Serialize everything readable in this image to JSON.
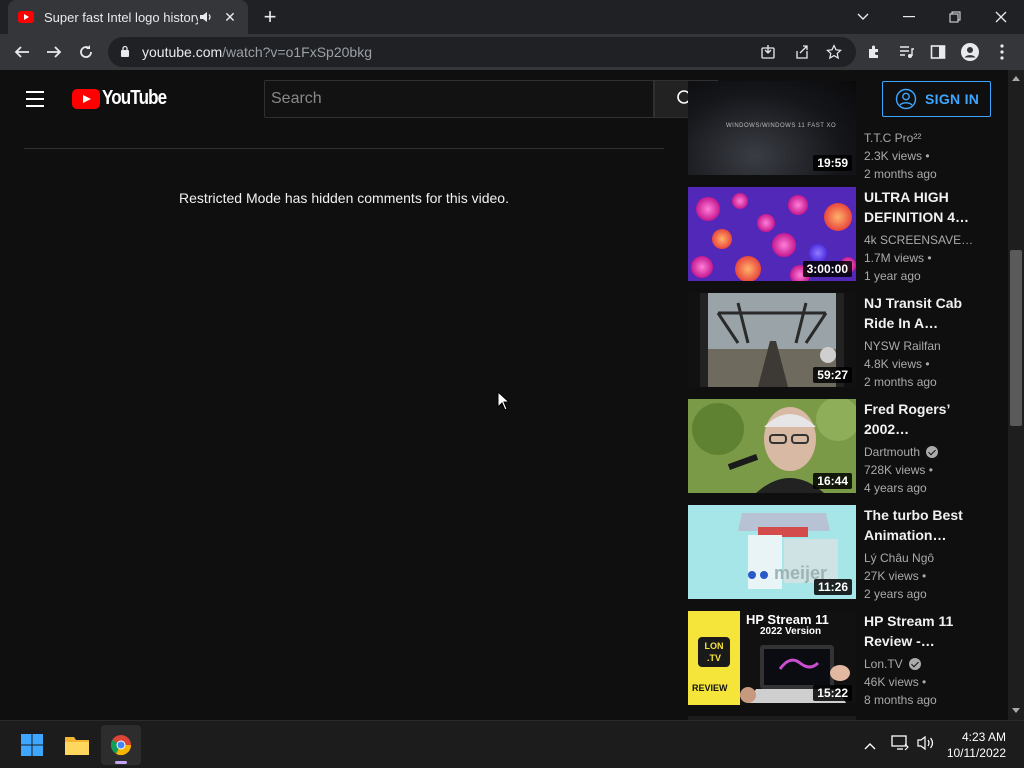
{
  "browser": {
    "tab_title": "Super fast Intel logo history",
    "new_tab_label": "+",
    "url_domain": "youtube.com",
    "url_path": "/watch?v=o1FxSp20bkg"
  },
  "youtube": {
    "logo_text": "YouTube",
    "search_placeholder": "Search",
    "signin_label": "SIGN IN"
  },
  "main": {
    "restricted_message": "Restricted Mode has hidden comments for this video."
  },
  "related": [
    {
      "title": "",
      "channel": "T.T.C Pro²²",
      "views": "2.3K views •",
      "ago": "2 months ago",
      "duration": "19:59",
      "verified": false
    },
    {
      "title": "ULTRA HIGH DEFINITION 4…",
      "channel": "4k SCREENSAVE…",
      "views": "1.7M views •",
      "ago": "1 year ago",
      "duration": "3:00:00",
      "verified": false
    },
    {
      "title": "NJ Transit Cab Ride In A…",
      "channel": "NYSW Railfan",
      "views": "4.8K views •",
      "ago": "2 months ago",
      "duration": "59:27",
      "verified": false
    },
    {
      "title": "Fred Rogers’ 2002…",
      "channel": "Dartmouth",
      "views": "728K views •",
      "ago": "4 years ago",
      "duration": "16:44",
      "verified": true
    },
    {
      "title": "The turbo Best Animation…",
      "channel": "Lý Châu Ngô",
      "views": "27K views •",
      "ago": "2 years ago",
      "duration": "11:26",
      "verified": false
    },
    {
      "title": "HP Stream 11 Review -…",
      "channel": "Lon.TV",
      "views": "46K views •",
      "ago": "8 months ago",
      "duration": "15:22",
      "verified": true
    }
  ],
  "thumb_text": {
    "first_overlay": "WINDOWS/WINDOWS 11 FAST XO",
    "hp_line1": "HP Stream 11",
    "hp_line2": "2022 Version",
    "lon_badge": "LON",
    "lon_badge2": ".TV",
    "review_label": "REVIEW",
    "meijer_text": "meijer"
  },
  "taskbar": {
    "time": "4:23 AM",
    "date": "10/11/2022"
  },
  "colors": {
    "yt_red": "#ff0000",
    "link_blue": "#3ea6ff",
    "background": "#0f0f0f"
  }
}
